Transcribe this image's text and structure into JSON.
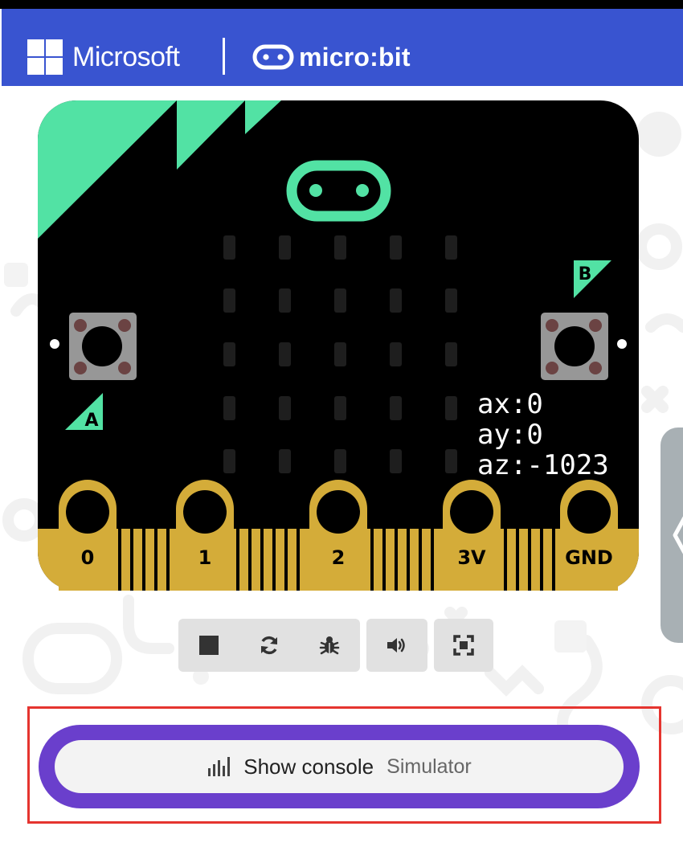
{
  "header": {
    "brand": "Microsoft",
    "product": "micro:bit",
    "bg_color": "#3954d0"
  },
  "board": {
    "body_color": "#000000",
    "accent_color": "#52e2a4",
    "pin_color": "#d4ac39",
    "button_a_label": "A",
    "button_b_label": "B",
    "pins": [
      "0",
      "1",
      "2",
      "3V",
      "GND"
    ],
    "led_matrix": {
      "rows": 5,
      "cols": 5,
      "lit": 0
    },
    "readout": {
      "ax": "ax:0",
      "ay": "ay:0",
      "az": "az:-1023"
    }
  },
  "toolbar": {
    "stop_icon": "stop-icon",
    "restart_icon": "restart-icon",
    "debug_icon": "bug-icon",
    "sound_icon": "volume-icon",
    "fullscreen_icon": "fullscreen-icon"
  },
  "console": {
    "icon": "bar-chart-icon",
    "label": "Show console",
    "sub_label": "Simulator",
    "ring_color": "#6a3fcc",
    "highlight_color": "#e5342f"
  }
}
